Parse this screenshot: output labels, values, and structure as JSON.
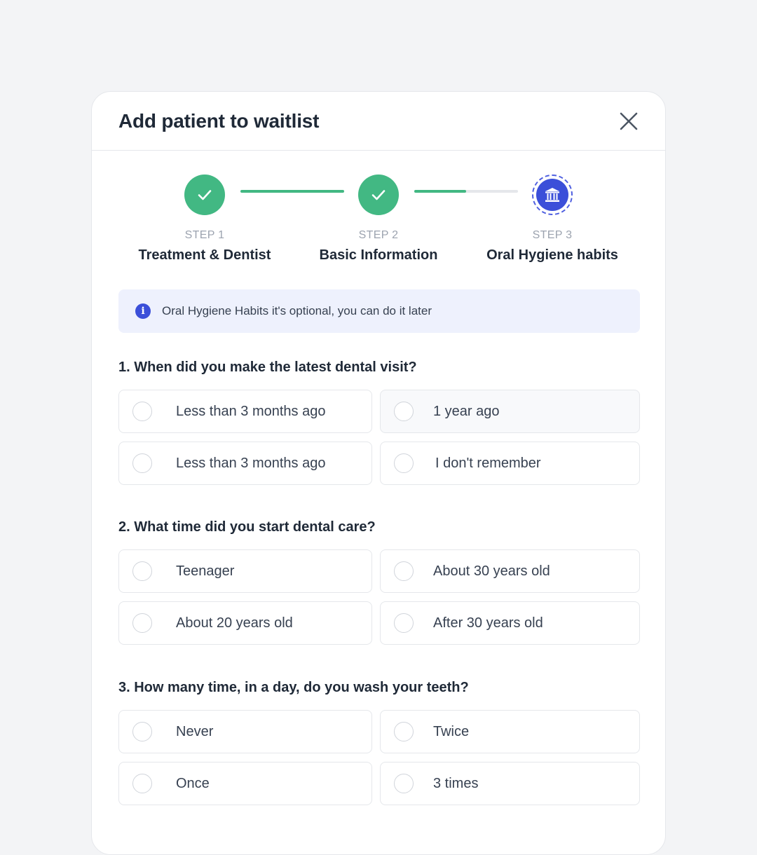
{
  "header": {
    "title": "Add patient to waitlist"
  },
  "stepper": {
    "steps": [
      {
        "number": "STEP 1",
        "name": "Treatment & Dentist",
        "status": "done"
      },
      {
        "number": "STEP 2",
        "name": "Basic Information",
        "status": "done"
      },
      {
        "number": "STEP 3",
        "name": "Oral Hygiene habits",
        "status": "current"
      }
    ],
    "colors": {
      "done": "#42b883",
      "current": "#3b4fd9",
      "track": "#e5e7eb"
    }
  },
  "info": {
    "text": "Oral Hygiene Habits it's optional, you can do it later"
  },
  "questions": [
    {
      "title": "1. When did you make the latest dental visit?",
      "options": [
        "Less than 3 months ago",
        "1 year ago",
        "Less than 3 months ago",
        "I don't remember"
      ]
    },
    {
      "title": "2. What time did you start dental care?",
      "options": [
        "Teenager",
        "About 30 years old",
        "About 20 years old",
        "After 30 years old"
      ]
    },
    {
      "title": "3. How many time, in a day, do you wash your teeth?",
      "options": [
        "Never",
        "Twice",
        "Once",
        "3 times"
      ]
    }
  ]
}
